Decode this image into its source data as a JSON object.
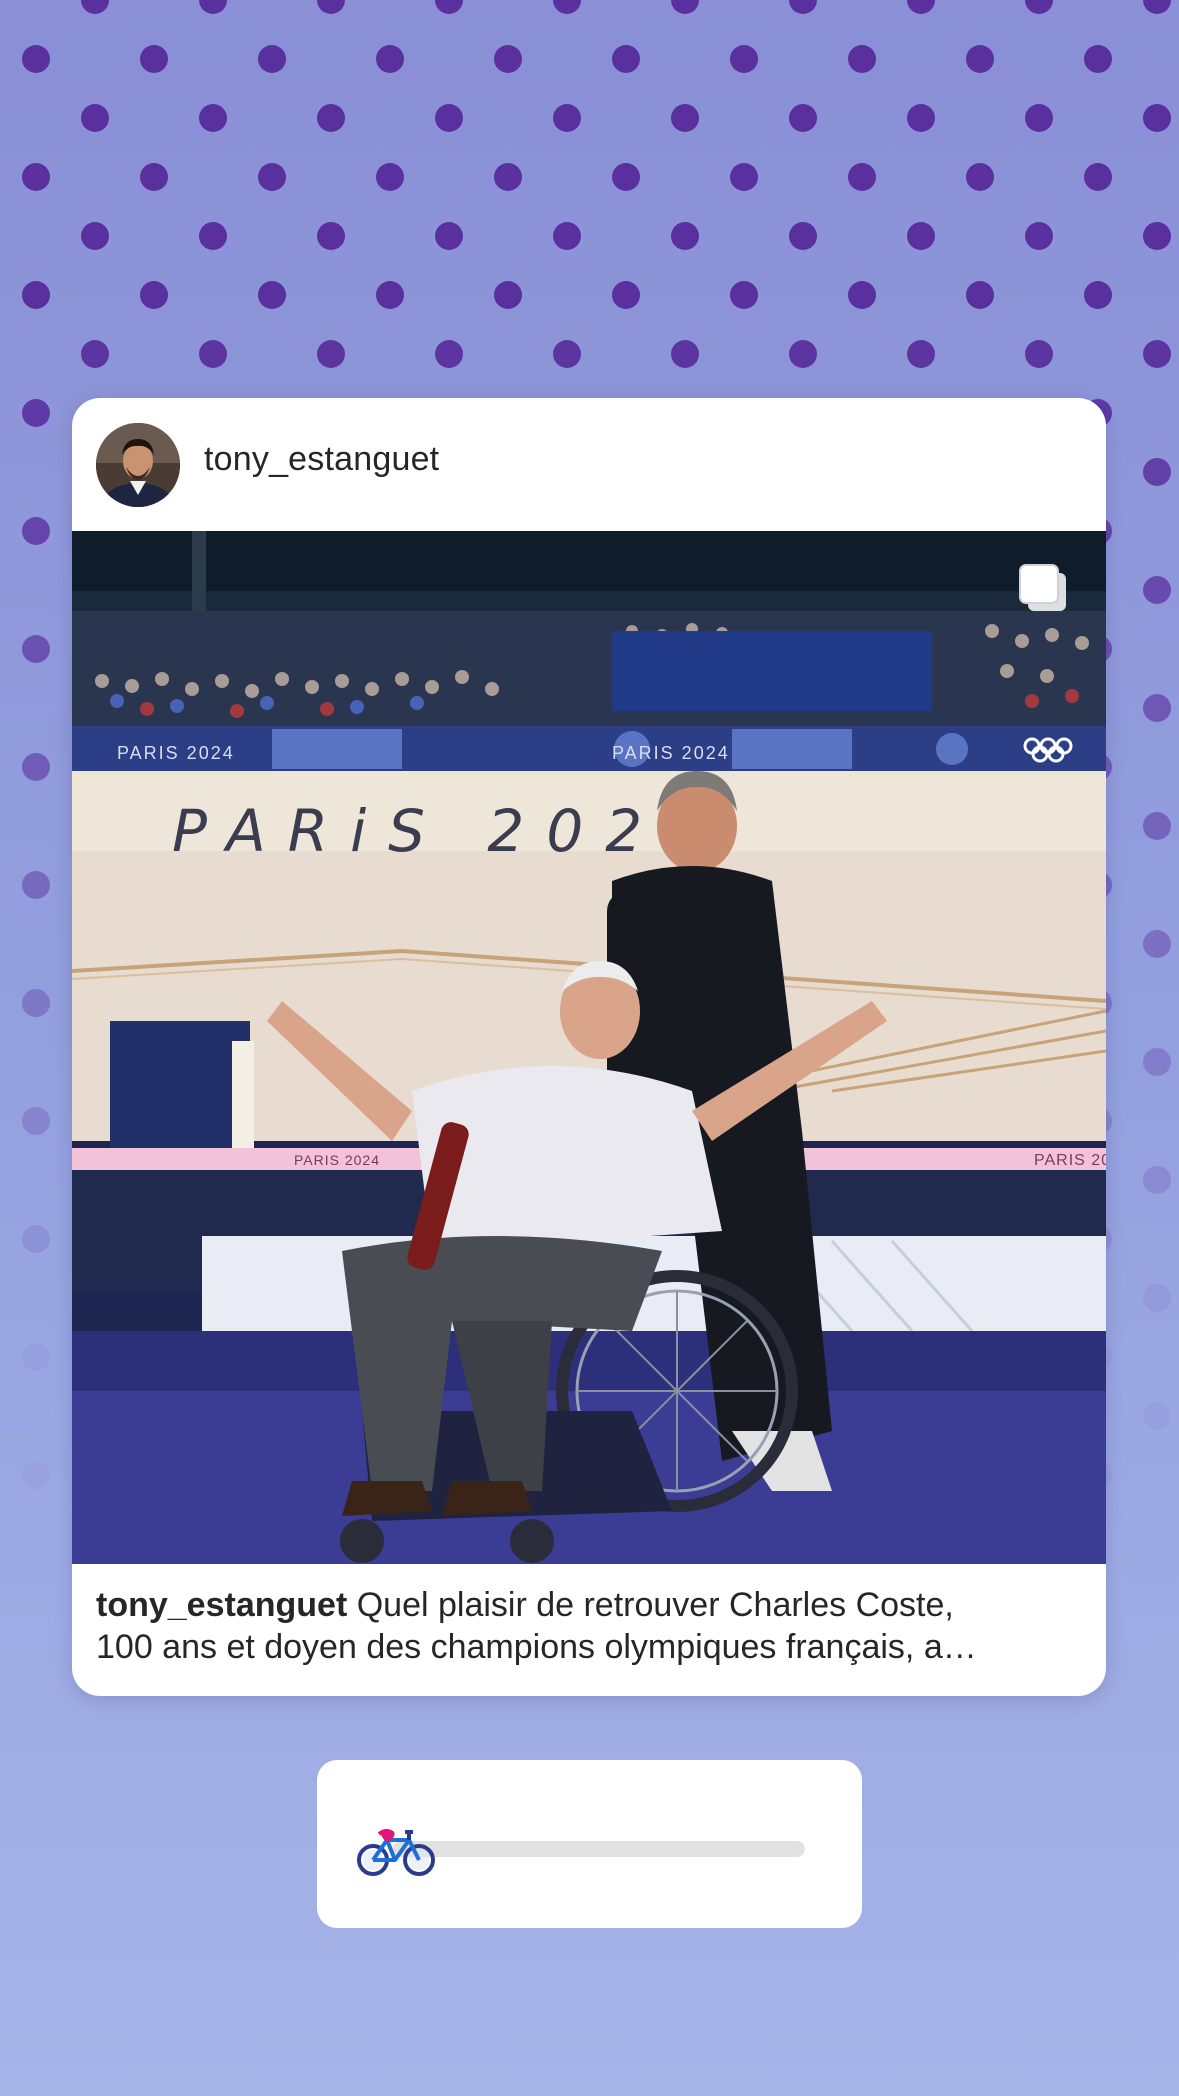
{
  "post": {
    "username": "tony_estanguet",
    "caption_user": "tony_estanguet",
    "caption_line1_rest": " Quel plaisir de retrouver Charles Coste,",
    "caption_line2": "100 ans et doyen des champions olympiques français, a…",
    "photo_signage": {
      "big": "PARiS 2024",
      "banner_left": "PARIS 2024",
      "banner_mid": "PARIS 2024",
      "rail_left": "PARIS 2024",
      "rail_right": "PARIS 20"
    }
  },
  "slider": {
    "emoji": "bicycle-icon",
    "value": 0
  },
  "colors": {
    "background_top": "#8a8fd6",
    "background_bottom": "#a6b4e8",
    "dots": "#5a2f9e",
    "card": "#ffffff",
    "track": "#e1e1e1"
  }
}
